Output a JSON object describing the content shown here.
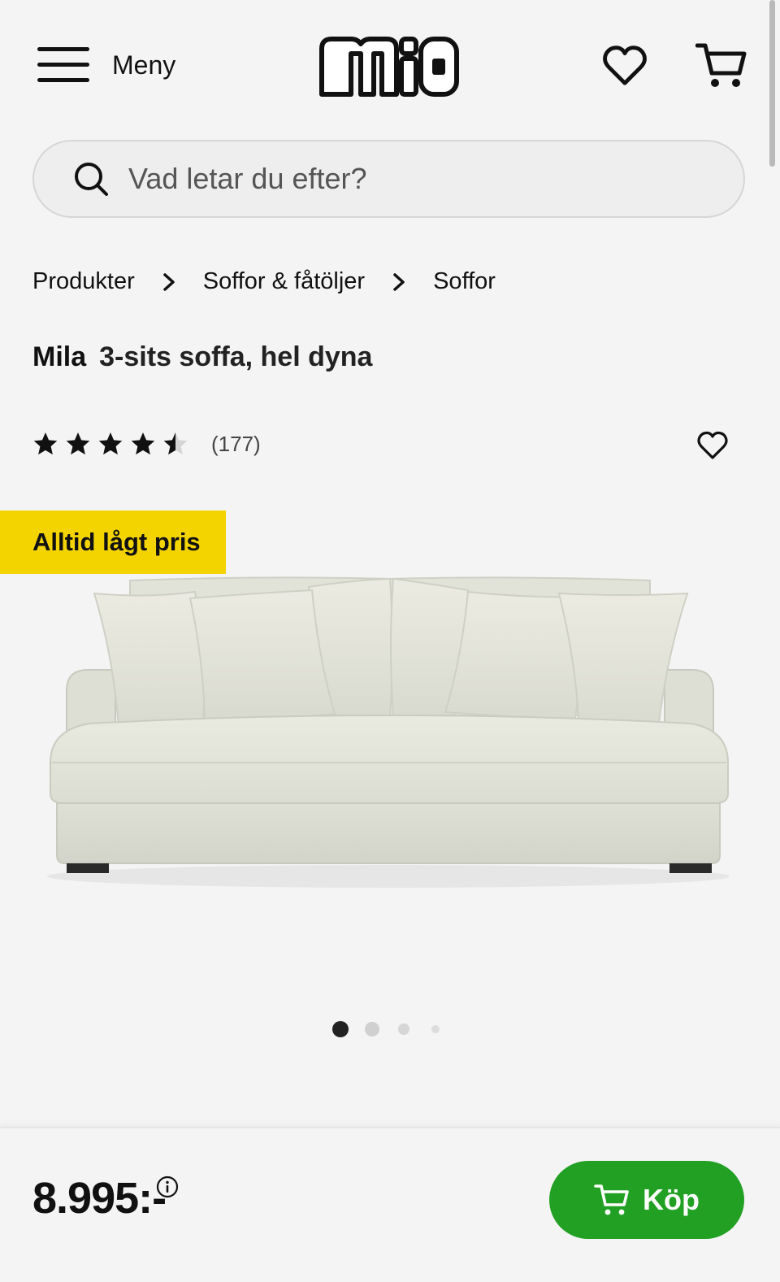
{
  "header": {
    "menu_label": "Meny",
    "logo_text": "mio"
  },
  "search": {
    "placeholder": "Vad letar du efter?"
  },
  "breadcrumb": [
    {
      "label": "Produkter"
    },
    {
      "label": "Soffor & fåtöljer"
    },
    {
      "label": "Soffor"
    }
  ],
  "product": {
    "brand": "Mila",
    "description": "3-sits soffa, hel dyna",
    "rating": 4.5,
    "rating_max": 5,
    "review_count": "(177)",
    "badge": "Alltid lågt pris",
    "image_count": 4,
    "active_image": 1
  },
  "bottom_bar": {
    "price": "8.995:-",
    "buy_label": "Köp"
  },
  "colors": {
    "background": "#f4f4f4",
    "badge": "#f4d400",
    "buy_button": "#22a024",
    "sofa_fabric": "#e4e5da"
  }
}
